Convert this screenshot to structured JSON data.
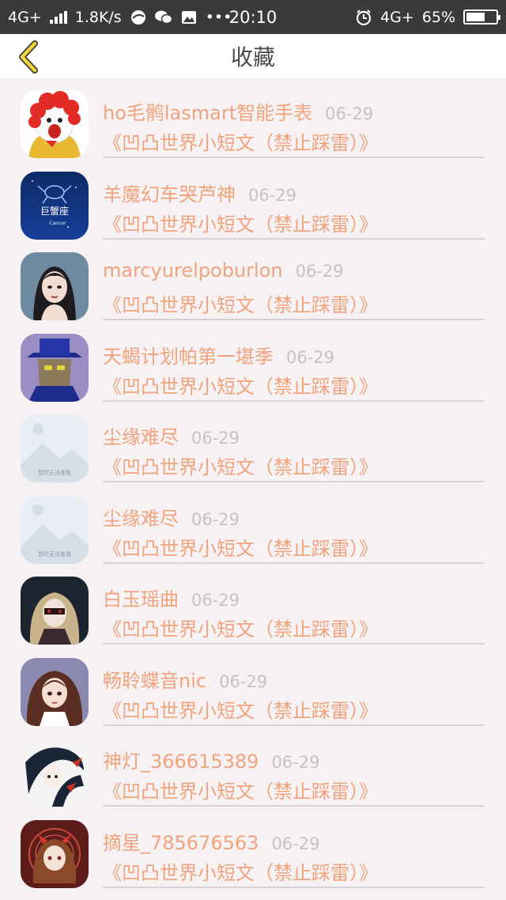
{
  "status_bar": {
    "network": "4G+",
    "speed": "1.8K/s",
    "dots": "•••",
    "time": "20:10",
    "network_right": "4G+",
    "battery_text": "65%",
    "battery_level": 0.65
  },
  "header": {
    "title": "收藏"
  },
  "items": [
    {
      "name": "ho毛鹘lasmart智能手表",
      "date": "06-29",
      "book": "《凹凸世界小短文（禁止踩雷）》",
      "avatar": "clown"
    },
    {
      "name": "羊魔幻车哭芦神",
      "date": "06-29",
      "book": "《凹凸世界小短文（禁止踩雷）》",
      "avatar": "cancer",
      "avatar_text": "巨蟹座"
    },
    {
      "name": "marcyurelpoburlon",
      "date": "06-29",
      "book": "《凹凸世界小短文（禁止踩雷）》",
      "avatar": "girl-gray"
    },
    {
      "name": "天蝎计划帕第一堪季",
      "date": "06-29",
      "book": "《凹凸世界小短文（禁止踩雷）》",
      "avatar": "hat-man"
    },
    {
      "name": "尘缘难尽",
      "date": "06-29",
      "book": "《凹凸世界小短文（禁止踩雷）》",
      "avatar": "placeholder",
      "avatar_text": "暂时无法查看"
    },
    {
      "name": "尘缘难尽",
      "date": "06-29",
      "book": "《凹凸世界小短文（禁止踩雷）》",
      "avatar": "placeholder",
      "avatar_text": "暂时无法查看"
    },
    {
      "name": "白玉瑶曲",
      "date": "06-29",
      "book": "《凹凸世界小短文（禁止踩雷）》",
      "avatar": "dark-girl"
    },
    {
      "name": "畅聆蝶音nic",
      "date": "06-29",
      "book": "《凹凸世界小短文（禁止踩雷）》",
      "avatar": "anime-girl"
    },
    {
      "name": "神灯_366615389",
      "date": "06-29",
      "book": "《凹凸世界小短文（禁止踩雷）》",
      "avatar": "ink-girl"
    },
    {
      "name": "摘星_785676563",
      "date": "06-29",
      "book": "《凹凸世界小短文（禁止踩雷）》",
      "avatar": "red-girl"
    }
  ]
}
